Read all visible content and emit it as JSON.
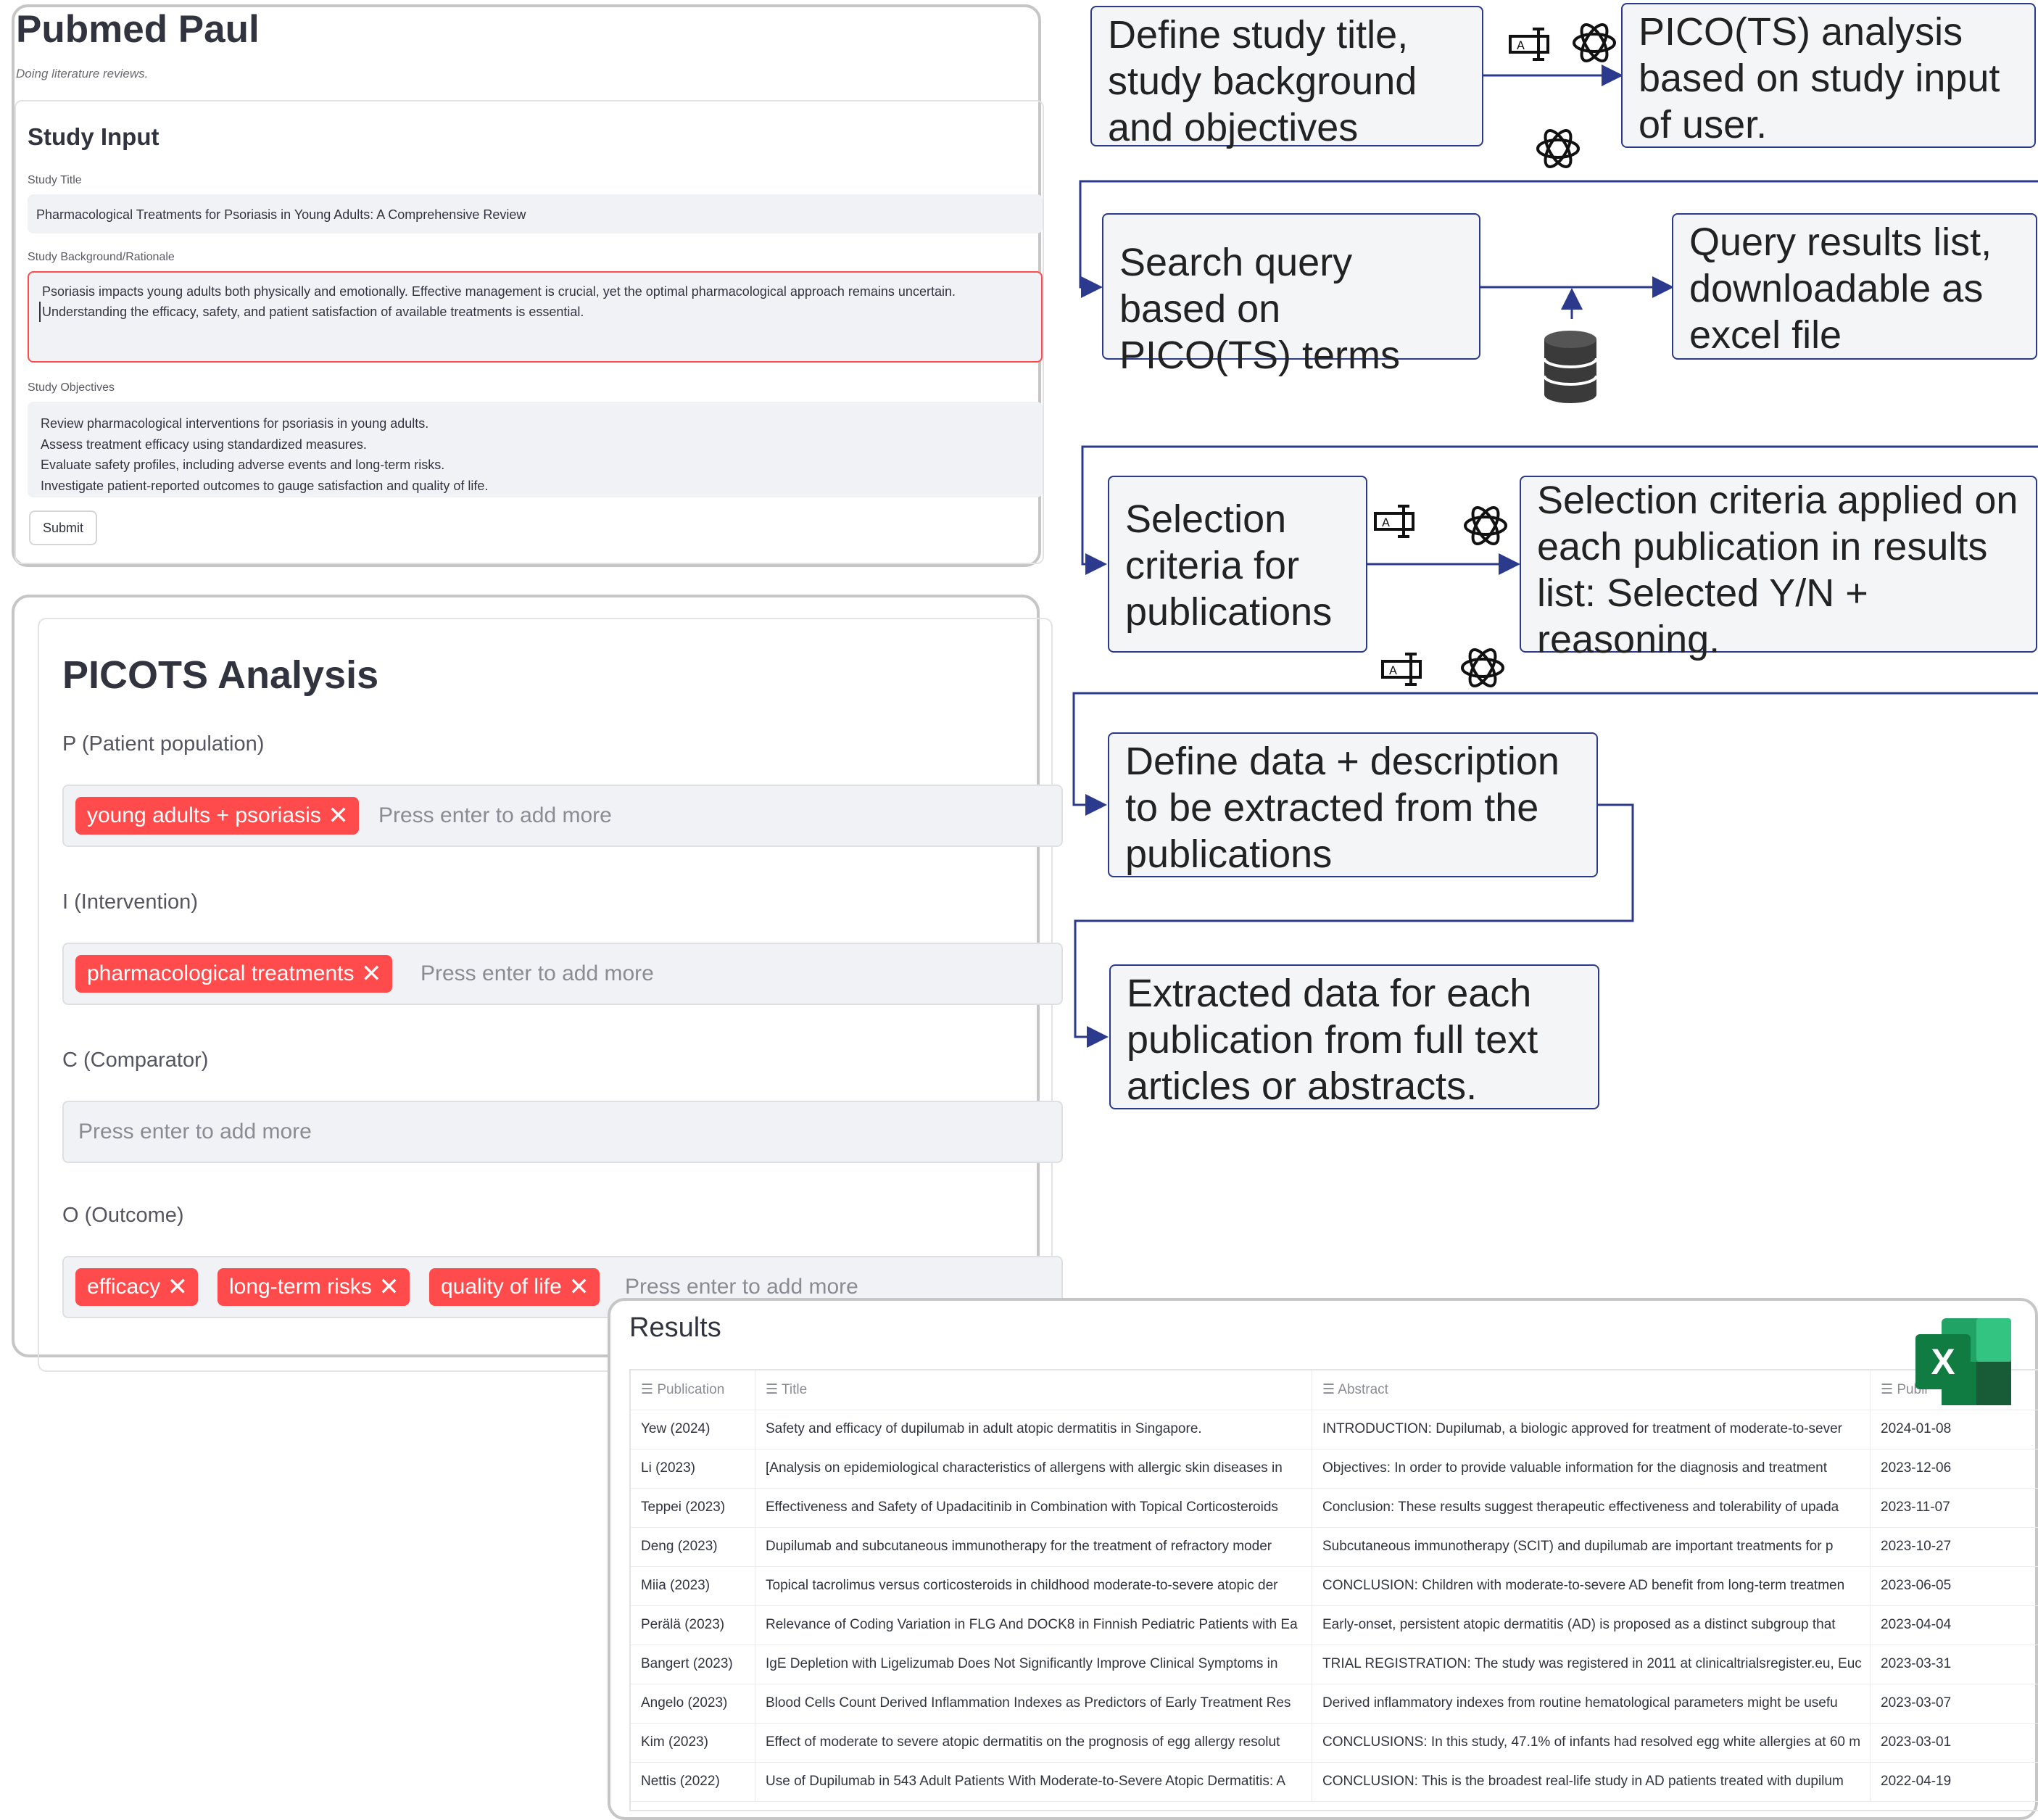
{
  "study_app": {
    "title": "Pubmed Paul",
    "caption": "Doing literature reviews.",
    "form_heading": "Study Input",
    "title_label": "Study Title",
    "title_value": "Pharmacological Treatments for Psoriasis in Young Adults: A Comprehensive Review",
    "background_label": "Study Background/Rationale",
    "background_lines": [
      "Psoriasis impacts young adults both physically and emotionally. Effective management is crucial, yet the optimal pharmacological approach remains uncertain.",
      "Understanding the efficacy, safety, and patient satisfaction of available treatments is essential."
    ],
    "objectives_label": "Study Objectives",
    "objective_lines": [
      "Review pharmacological interventions for psoriasis in young adults.",
      "Assess treatment efficacy using standardized measures.",
      "Evaluate safety profiles, including adverse events and long-term risks.",
      "Investigate patient-reported outcomes to gauge satisfaction and quality of life."
    ],
    "submit_label": "Submit"
  },
  "picots": {
    "heading": "PICOTS Analysis",
    "placeholder": "Press enter to add more",
    "chip_close": "✕",
    "p_label": "P (Patient population)",
    "p_tags": [
      "young adults + psoriasis"
    ],
    "i_label": "I (Intervention)",
    "i_tags": [
      "pharmacological treatments"
    ],
    "c_label": "C (Comparator)",
    "o_label": "O (Outcome)",
    "o_tags": [
      "efficacy",
      "long-term risks",
      "quality of life"
    ],
    "chip_color": "#ff4b4b"
  },
  "results": {
    "heading": "Results",
    "columns": [
      "Publication",
      "Title",
      "Abstract",
      "Publi"
    ],
    "rows": [
      [
        "Yew (2024)",
        "Safety and efficacy of dupilumab in adult atopic dermatitis in Singapore.",
        "INTRODUCTION: Dupilumab, a biologic approved for treatment of moderate-to-sever",
        "2024-01-08"
      ],
      [
        "Li (2023)",
        "[Analysis on epidemiological characteristics of allergens with allergic skin diseases in",
        "Objectives: In order to provide valuable information for the diagnosis and treatment",
        "2023-12-06"
      ],
      [
        "Teppei (2023)",
        "Effectiveness and Safety of Upadacitinib in Combination with Topical Corticosteroids",
        "Conclusion: These results suggest therapeutic effectiveness and tolerability of upada",
        "2023-11-07"
      ],
      [
        "Deng (2023)",
        "Dupilumab and subcutaneous immunotherapy for the treatment of refractory moder",
        "Subcutaneous immunotherapy (SCIT) and dupilumab are important treatments for p",
        "2023-10-27"
      ],
      [
        "Miia (2023)",
        "Topical tacrolimus versus corticosteroids in childhood moderate-to-severe atopic der",
        "CONCLUSION: Children with moderate-to-severe AD benefit from long-term treatmen",
        "2023-06-05"
      ],
      [
        "Perälä (2023)",
        "Relevance of Coding Variation in FLG And DOCK8 in Finnish Pediatric Patients with Ea",
        "Early-onset, persistent atopic dermatitis (AD) is proposed as a distinct subgroup that",
        "2023-04-04"
      ],
      [
        "Bangert (2023)",
        "IgE Depletion with Ligelizumab Does Not Significantly Improve Clinical Symptoms in",
        "TRIAL REGISTRATION: The study was registered in 2011 at clinicaltrialsregister.eu, Euc",
        "2023-03-31"
      ],
      [
        "Angelo (2023)",
        "Blood Cells Count Derived Inflammation Indexes as Predictors of Early Treatment Res",
        "Derived inflammatory indexes from routine hematological parameters might be usefu",
        "2023-03-07"
      ],
      [
        "Kim (2023)",
        "Effect of moderate to severe atopic dermatitis on the prognosis of egg allergy resolut",
        "CONCLUSIONS: In this study, 47.1% of infants had resolved egg white allergies at 60 m",
        "2023-03-01"
      ],
      [
        "Nettis (2022)",
        "Use of Dupilumab in 543 Adult Patients With Moderate-to-Severe Atopic Dermatitis: A",
        "CONCLUSION: This is the broadest real-life study in AD patients treated with dupilum",
        "2022-04-19"
      ]
    ],
    "excel_letter": "X"
  },
  "flow": {
    "boxes": [
      "Define study title, study background and objectives",
      "PICO(TS) analysis based on study input of user.",
      "Search query based on PICO(TS) terms",
      "Query results list, downloadable as excel file",
      "Selection criteria for publications",
      "Selection criteria applied on each publication in results list: Selected Y/N + reasoning.",
      "Define data + description to be extracted from the publications",
      "Extracted data for each publication from full text articles or abstracts."
    ],
    "line_color": "#2b3a8c"
  }
}
